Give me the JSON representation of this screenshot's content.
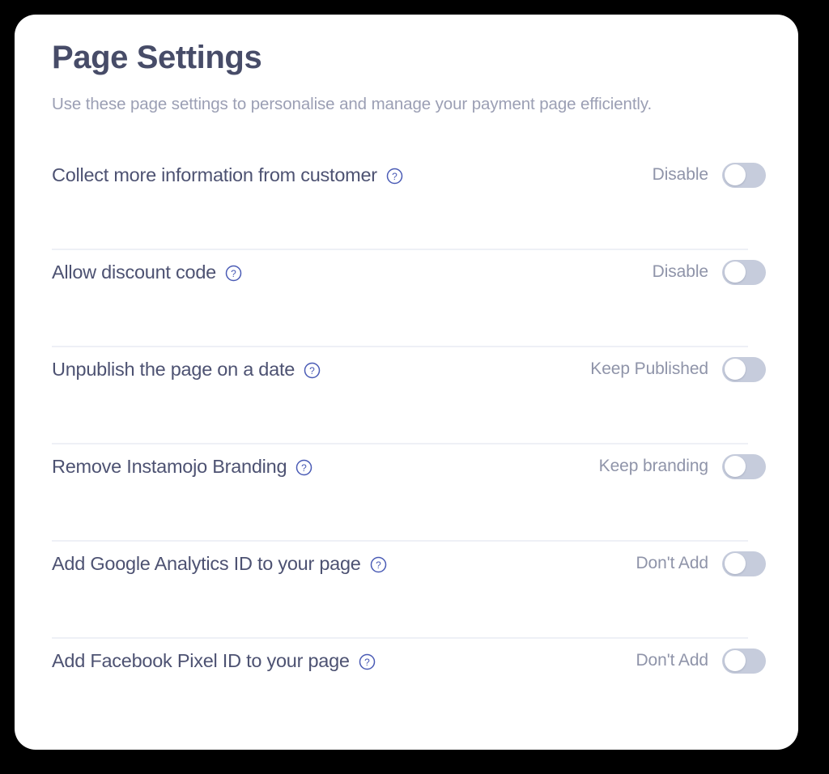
{
  "header": {
    "title": "Page Settings",
    "subtitle": "Use these page settings to personalise and manage your payment page efficiently."
  },
  "colors": {
    "card_background": "#ffffff",
    "page_background": "#000000",
    "title_text": "#474c68",
    "subtitle_text": "#9b9fb4",
    "label_text": "#4d5272",
    "status_text": "#8f94a9",
    "toggle_off_track": "#c6ccdc",
    "toggle_knob": "#ffffff",
    "help_icon": "#4a5bb5",
    "separator": "#eef0f6"
  },
  "settings": [
    {
      "label": "Collect more information from customer",
      "help_icon": "question-mark-circle-icon",
      "status": "Disable",
      "toggle_state": "off"
    },
    {
      "label": "Allow discount code",
      "help_icon": "question-mark-circle-icon",
      "status": "Disable",
      "toggle_state": "off"
    },
    {
      "label": "Unpublish the page on a date",
      "help_icon": "question-mark-circle-icon",
      "status": "Keep Published",
      "toggle_state": "off"
    },
    {
      "label": "Remove Instamojo Branding",
      "help_icon": "question-mark-circle-icon",
      "status": "Keep branding",
      "toggle_state": "off"
    },
    {
      "label": "Add Google Analytics ID to your page",
      "help_icon": "question-mark-circle-icon",
      "status": "Don't Add",
      "toggle_state": "off"
    },
    {
      "label": "Add Facebook Pixel ID to your page",
      "help_icon": "question-mark-circle-icon",
      "status": "Don't Add",
      "toggle_state": "off"
    }
  ]
}
